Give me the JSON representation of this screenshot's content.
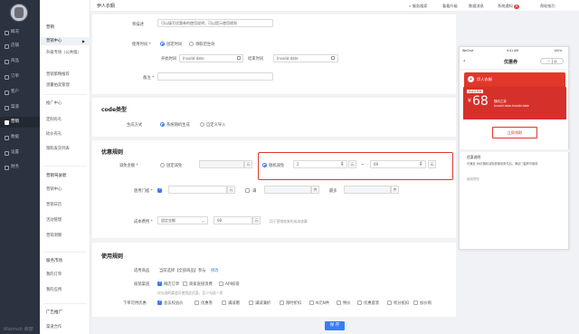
{
  "sidebar": {
    "items": [
      {
        "label": "概况",
        "icon": "home-icon"
      },
      {
        "label": "店铺",
        "icon": "store-icon"
      },
      {
        "label": "商品",
        "icon": "goods-icon"
      },
      {
        "label": "订单",
        "icon": "order-icon"
      },
      {
        "label": "客户",
        "icon": "customer-icon"
      },
      {
        "label": "渠道",
        "icon": "channel-icon"
      },
      {
        "label": "营销",
        "icon": "marketing-icon"
      },
      {
        "label": "数据",
        "icon": "data-icon"
      },
      {
        "label": "设置",
        "icon": "settings-icon"
      },
      {
        "label": "财务",
        "icon": "finance-icon"
      }
    ],
    "brand": "Weimob 微盟"
  },
  "subnav": {
    "title": "营销",
    "items": [
      "营销中心",
      "升级专场（公共版）",
      "营销策略推荐",
      "测量拍卖管理",
      "推广中心",
      "定制有礼",
      "砍价有礼",
      "限购发货列表",
      "营销驾驶舱",
      "营销中心",
      "营销日历",
      "活动管理",
      "营销洞察",
      "服务市场",
      "我的订单",
      "我的应用",
      "广告推广",
      "渠道合作"
    ],
    "section_titles": [
      "营销驾驶舱",
      "服务市场",
      "广告推广"
    ]
  },
  "topbar": {
    "store": "伊人衣橱",
    "search": "服务搜索",
    "links": [
      "看看升级",
      "数据消息",
      "系统通知",
      "帮助指引"
    ],
    "badge": "6"
  },
  "form": {
    "top_hint": "券描述",
    "top_placeholder": "可以填写优惠券的使用说明，可以提示使用规则",
    "valid_label": "使用时间 *",
    "valid_opt1": "固定时间",
    "valid_opt2": "领取后生效",
    "start_label": "开始时间",
    "start_ph": "Invalid date",
    "end_label": "结束时间",
    "end_ph": "Invalid date",
    "notes_label": "备注 *",
    "code_title": "code类型",
    "code_label": "生成方式",
    "code_opt1": "系统随机生成",
    "code_opt2": "自定义导入",
    "rule_title": "优惠规则",
    "reduce_label": "减免金额 *",
    "fixed_opt": "固定减免",
    "yuan": "元",
    "random_opt": "随机减免",
    "random_min": "2",
    "random_max": "69",
    "tilde": "~",
    "threshold_label": "使用门槛 *",
    "threshold_note": "满",
    "reach": "满",
    "stock_opt": "最多",
    "stock_unit": "件",
    "piece": "件",
    "cost_label": "成本费用 *",
    "cost_select": "固定金额",
    "cost_value": "68",
    "cost_unit": "元",
    "cost_hint": "用于营销效果的成本核算",
    "use_title": "使用规则",
    "goods_label": "适用商品",
    "goods_text": "当前选择【全部商品】参与",
    "goods_link": "修改",
    "channel_label": "核销渠道",
    "channel_opts": [
      "网店订单",
      "商家直接消费",
      "API核销"
    ],
    "channel_hint": "仅勾选的渠道可使用此优惠，至少勾选一项",
    "scene_label": "下单可用优惠",
    "scene_opts": [
      "会员权益价",
      "优惠券",
      "满减赠",
      "满减满折",
      "限时折扣",
      "N元N件",
      "特价",
      "优惠套装",
      "积分抵扣",
      "加价购"
    ],
    "save": "保 存"
  },
  "phone": {
    "time": "9:41 AM",
    "signal": "WeChat",
    "battery": "100%",
    "title": "优惠券",
    "shop": "伊人衣橱",
    "coupon_badge": "满减优惠券",
    "amount": "68",
    "currency": "¥",
    "amount_note": "随机立减",
    "coupon_dates": "Invalid date-Invalid date",
    "get_button": "立即领取",
    "desc_title": "优惠说明",
    "desc_text": "可满足 68元随机减免券使用条件后，满足门槛即可使用",
    "rules_title": "使用须知"
  },
  "colors": {
    "accent": "#3a7cf5",
    "brand_red": "#e0382b",
    "sidebar": "#2c3340"
  }
}
